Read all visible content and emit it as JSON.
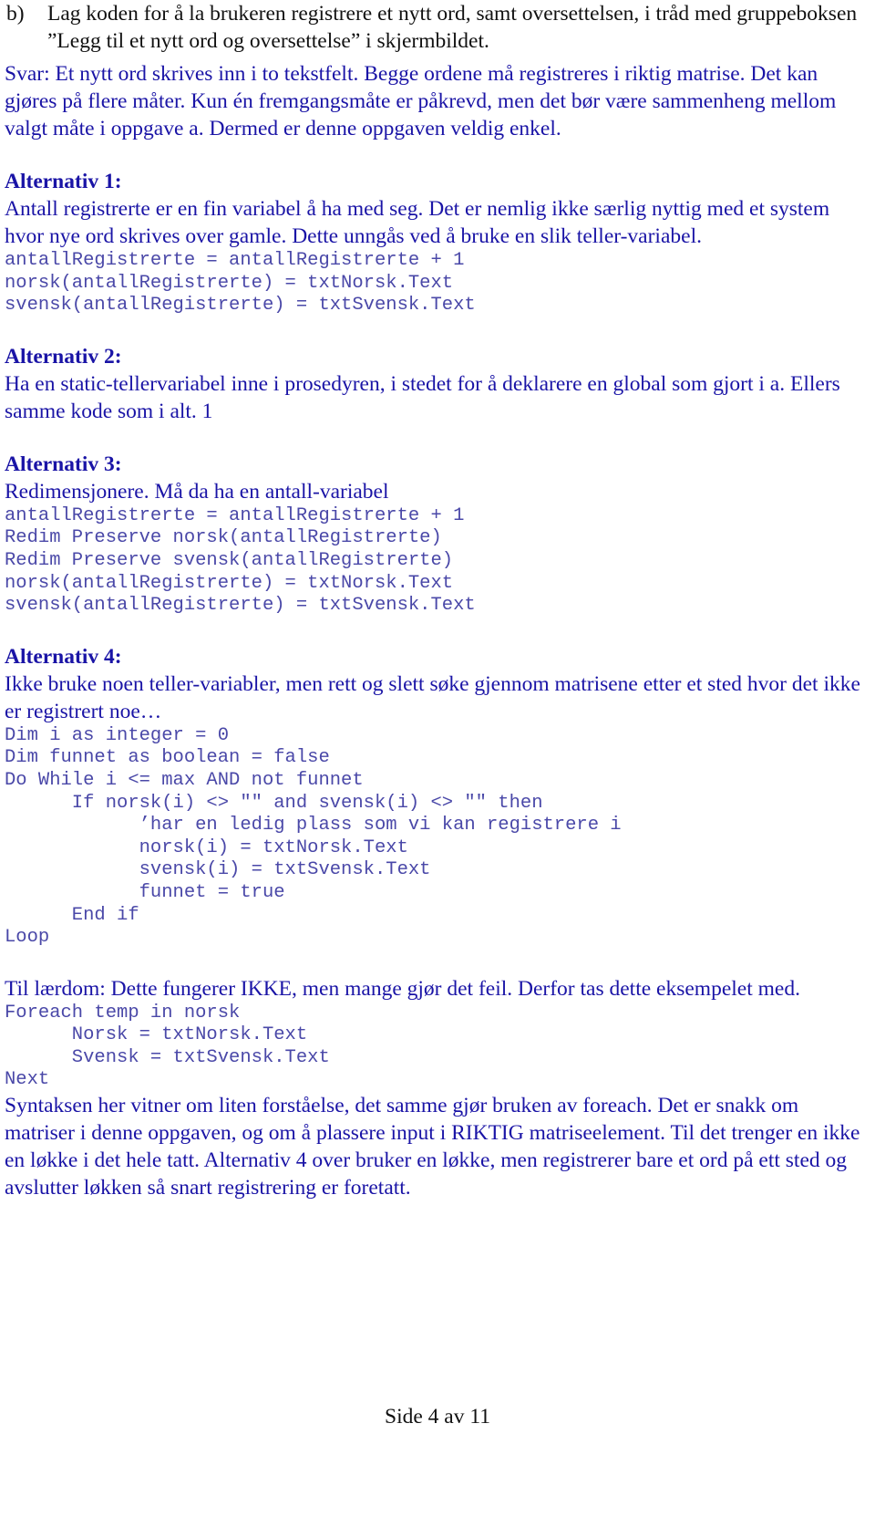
{
  "question": {
    "label": "b)",
    "text": "Lag koden for å la brukeren registrere et nytt ord, samt oversettelsen, i tråd med gruppeboksen ”Legg til et nytt ord og oversettelse” i skjermbildet."
  },
  "answer_intro": "Svar: Et nytt ord skrives inn i to tekstfelt. Begge ordene må registreres i riktig matrise. Det kan gjøres på flere måter. Kun én fremgangsmåte er påkrevd, men det bør være sammenheng mellom valgt måte i oppgave a. Dermed er denne oppgaven veldig enkel.",
  "alternatives": [
    {
      "heading": "Alternativ 1:",
      "text": "Antall registrerte er en fin variabel å ha med seg. Det er nemlig ikke særlig nyttig med et system hvor nye ord skrives over gamle. Dette unngås ved å bruke en slik teller-variabel.",
      "code": [
        "antallRegistrerte = antallRegistrerte + 1",
        "norsk(antallRegistrerte) = txtNorsk.Text",
        "svensk(antallRegistrerte) = txtSvensk.Text"
      ]
    },
    {
      "heading": "Alternativ 2:",
      "text": "Ha en static-tellervariabel inne i prosedyren, i stedet for å deklarere en global som gjort i a. Ellers samme kode som i alt. 1",
      "code": []
    },
    {
      "heading": "Alternativ 3:",
      "text": "Redimensjonere. Må da ha en antall-variabel",
      "code": [
        "antallRegistrerte = antallRegistrerte + 1",
        "Redim Preserve norsk(antallRegistrerte)",
        "Redim Preserve svensk(antallRegistrerte)",
        "norsk(antallRegistrerte) = txtNorsk.Text",
        "svensk(antallRegistrerte) = txtSvensk.Text"
      ]
    },
    {
      "heading": "Alternativ 4:",
      "text": "Ikke bruke noen teller-variabler, men rett og slett søke gjennom matrisene etter et sted hvor det ikke er registrert noe…",
      "code": [
        "Dim i as integer = 0",
        "Dim funnet as boolean = false",
        "Do While i <= max AND not funnet",
        "      If norsk(i) <> \"\" and svensk(i) <> \"\" then",
        "            ’har en ledig plass som vi kan registrere i",
        "            norsk(i) = txtNorsk.Text",
        "            svensk(i) = txtSvensk.Text",
        "            funnet = true",
        "      End if",
        "Loop"
      ]
    }
  ],
  "lesson": {
    "text": "Til lærdom: Dette fungerer IKKE, men mange gjør det feil. Derfor tas dette eksempelet med.",
    "code": [
      "Foreach temp in norsk",
      "      Norsk = txtNorsk.Text",
      "      Svensk = txtSvensk.Text",
      "Next"
    ],
    "conclusion": "Syntaksen her vitner om liten forståelse, det samme gjør bruken av foreach. Det er snakk om matriser i denne oppgaven, og om å plassere input i RIKTIG matriseelement. Til det trenger en ikke en løkke i det hele tatt. Alternativ 4 over bruker en løkke, men registrerer bare et ord på ett sted og avslutter løkken så snart registrering er foretatt."
  },
  "footer": {
    "page_label": "Side 4 av 11"
  },
  "colors": {
    "question_text": "#111111",
    "answer_text": "#1a14a6",
    "code_text": "#4a48a8"
  }
}
